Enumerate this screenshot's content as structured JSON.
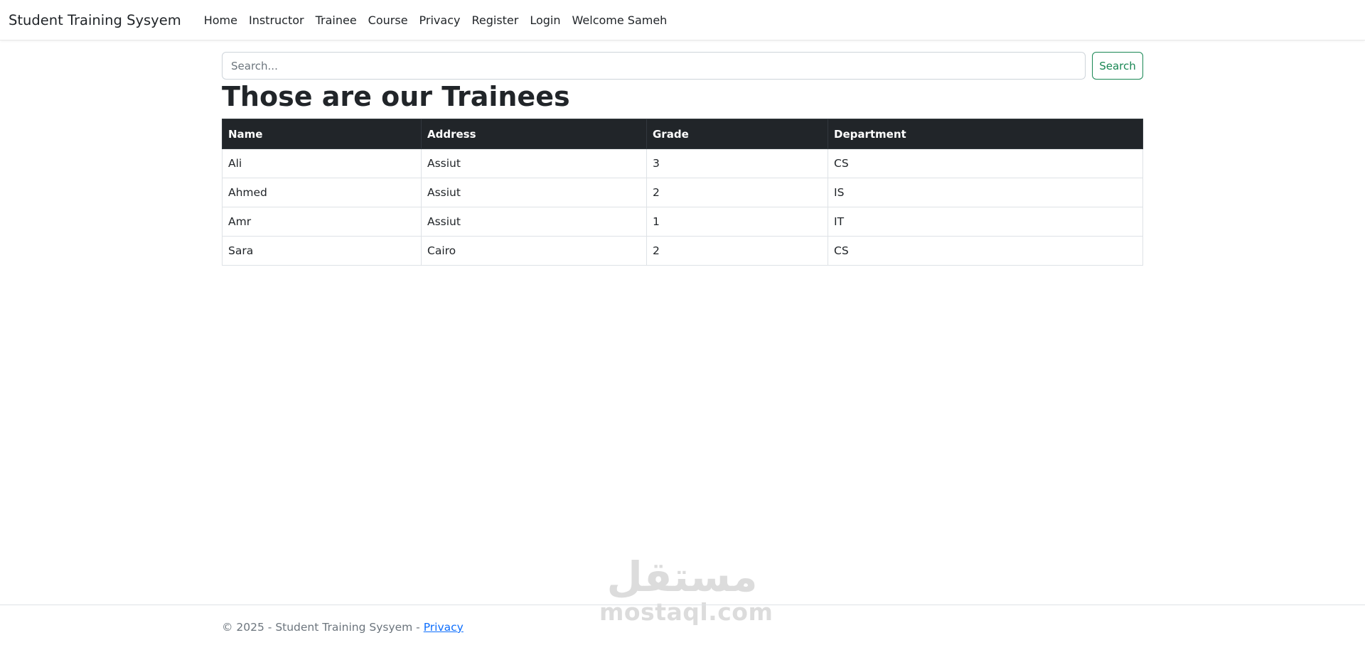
{
  "nav": {
    "brand": "Student Training Sysyem",
    "links": [
      "Home",
      "Instructor",
      "Trainee",
      "Course",
      "Privacy",
      "Register",
      "Login",
      "Welcome Sameh"
    ]
  },
  "search": {
    "placeholder": "Search...",
    "value": "",
    "button_label": "Search"
  },
  "main": {
    "title": "Those are our Trainees",
    "table": {
      "headers": [
        "Name",
        "Address",
        "Grade",
        "Department"
      ],
      "rows": [
        [
          "Ali",
          "Assiut",
          "3",
          "CS"
        ],
        [
          "Ahmed",
          "Assiut",
          "2",
          "IS"
        ],
        [
          "Amr",
          "Assiut",
          "1",
          "IT"
        ],
        [
          "Sara",
          "Cairo",
          "2",
          "CS"
        ]
      ]
    }
  },
  "footer": {
    "text": "© 2025 - Student Training Sysyem - ",
    "link": "Privacy"
  },
  "watermark": {
    "arabic": "مستقل",
    "latin": "mostaql.com"
  },
  "colors": {
    "header_bg": "#212529",
    "search_button": "#198754",
    "link": "#0d6efd"
  }
}
